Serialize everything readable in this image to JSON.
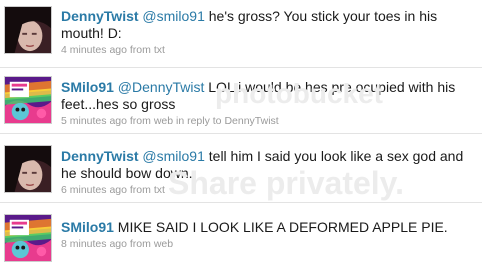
{
  "watermark": {
    "brand": "photobucket",
    "tagline": "Share privately."
  },
  "tweets": [
    {
      "screen_name": "DennyTwist",
      "mention": "@smilo91",
      "text": " he's gross? You stick your toes in his mouth! D:",
      "time": "4 minutes ago",
      "source_prefix": "from",
      "source": "txt",
      "reply_prefix": "",
      "reply_to": ""
    },
    {
      "screen_name": "SMilo91",
      "mention": "@DennyTwist",
      "text": " LOL i would be hes pre ocupied with his feet...hes so gross",
      "time": "5 minutes ago",
      "source_prefix": "from",
      "source": "web",
      "reply_prefix": "in reply to",
      "reply_to": "DennyTwist"
    },
    {
      "screen_name": "DennyTwist",
      "mention": "@smilo91",
      "text": " tell him I said you look like a sex god and he should bow down.",
      "time": "6 minutes ago",
      "source_prefix": "from",
      "source": "txt",
      "reply_prefix": "",
      "reply_to": ""
    },
    {
      "screen_name": "SMilo91",
      "mention": "",
      "text": "MIKE SAID I LOOK LIKE A DEFORMED APPLE PIE.",
      "time": "8 minutes ago",
      "source_prefix": "from",
      "source": "web",
      "reply_prefix": "",
      "reply_to": ""
    }
  ]
}
